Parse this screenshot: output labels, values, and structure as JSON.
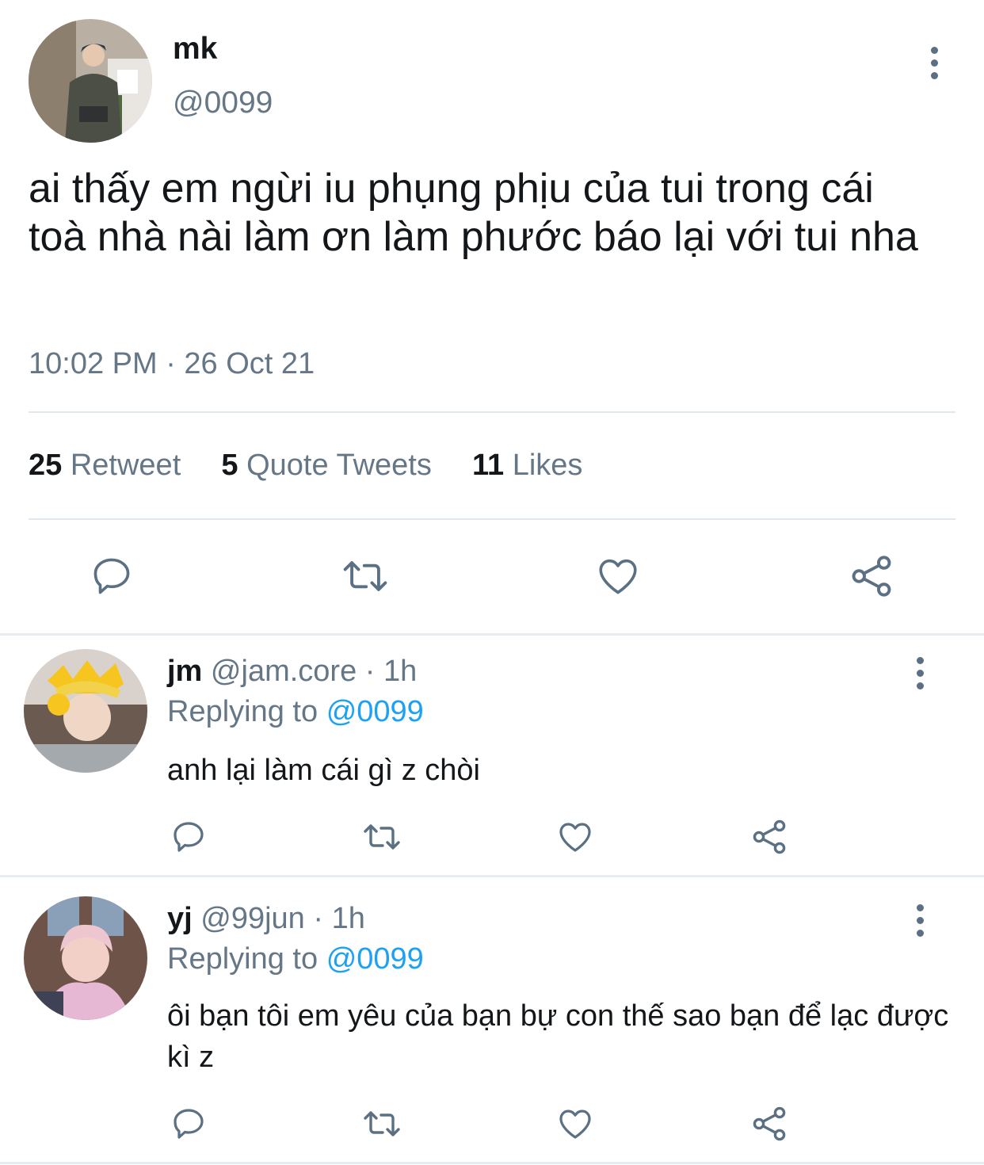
{
  "tweet": {
    "author_name": "mk",
    "author_handle": "@0099",
    "text": "ai thấy em ngừi iu phụng phịu của tui trong cái toà nhà nài làm ơn làm phước báo lại với tui nha",
    "timestamp": "10:02 PM · 26 Oct 21",
    "stats": {
      "retweets_count": "25",
      "retweets_label": "Retweet",
      "quotes_count": "5",
      "quotes_label": "Quote Tweets",
      "likes_count": "11",
      "likes_label": "Likes"
    }
  },
  "replies": [
    {
      "name": "jm",
      "handle": "@jam.core",
      "time": "· 1h",
      "replying_label": "Replying to",
      "replying_to": "@0099",
      "text": "anh lại làm cái gì z chòi"
    },
    {
      "name": "yj",
      "handle": "@99jun",
      "time": "· 1h",
      "replying_label": "Replying to",
      "replying_to": "@0099",
      "text": "ôi bạn tôi em yêu của bạn bự con thế sao bạn để lạc được kì z"
    }
  ],
  "icons": {
    "more": "more-vertical-icon",
    "reply": "reply-icon",
    "retweet": "retweet-icon",
    "like": "heart-icon",
    "share": "share-icon"
  },
  "colors": {
    "accent": "#1da1f2",
    "secondary_text": "#657786",
    "icon": "#5b7083"
  }
}
